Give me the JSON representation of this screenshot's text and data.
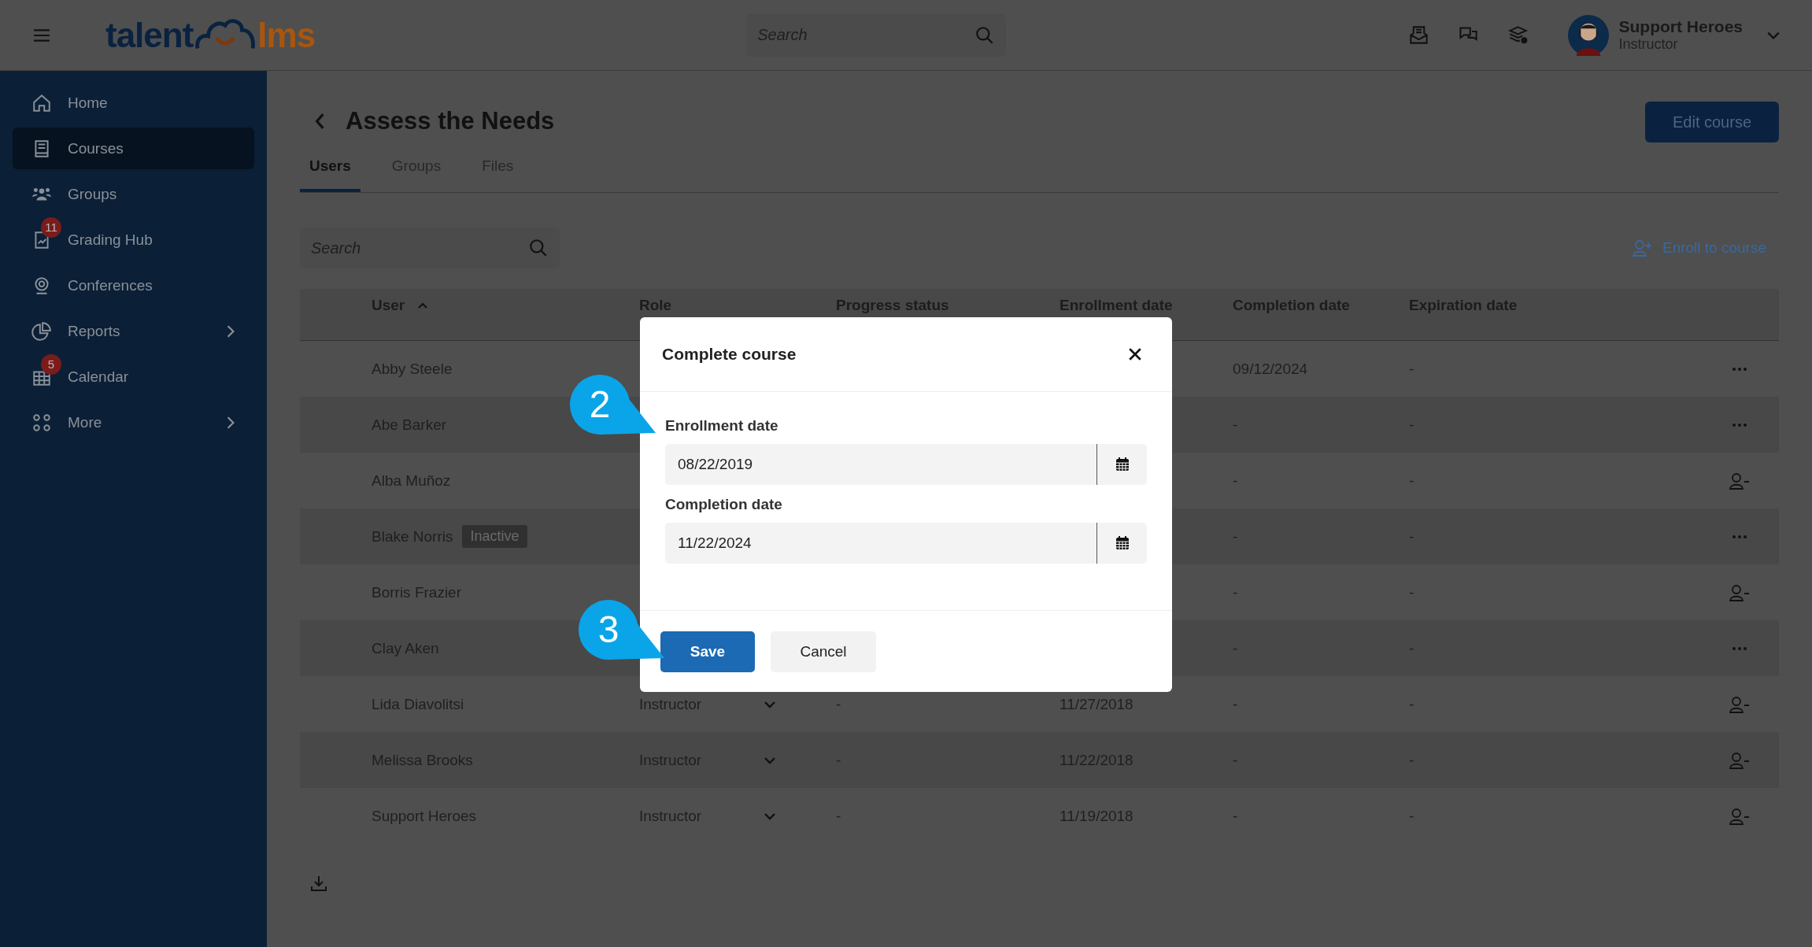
{
  "header": {
    "logo": {
      "left": "talent",
      "right": "lms"
    },
    "search": {
      "placeholder": "Search"
    },
    "user": {
      "name": "Support Heroes",
      "role": "Instructor"
    }
  },
  "sidebar": {
    "items": [
      {
        "label": "Home",
        "selected": false
      },
      {
        "label": "Courses",
        "selected": true
      },
      {
        "label": "Groups",
        "selected": false
      },
      {
        "label": "Grading Hub",
        "selected": false,
        "badge": "11"
      },
      {
        "label": "Conferences",
        "selected": false
      },
      {
        "label": "Reports",
        "selected": false,
        "submenu": true
      },
      {
        "label": "Calendar",
        "selected": false,
        "badge": "5"
      },
      {
        "label": "More",
        "selected": false,
        "submenu": true
      }
    ]
  },
  "page": {
    "title": "Assess the Needs",
    "edit_button": "Edit course",
    "tabs": [
      {
        "label": "Users",
        "selected": true
      },
      {
        "label": "Groups",
        "selected": false
      },
      {
        "label": "Files",
        "selected": false
      }
    ],
    "search": {
      "placeholder": "Search"
    },
    "enroll_link": "Enroll to course"
  },
  "table": {
    "columns": [
      "User",
      "Role",
      "Progress status",
      "Enrollment date",
      "Completion date",
      "Expiration date"
    ],
    "rows": [
      {
        "user": "Abby Steele",
        "completion": "09/12/2024",
        "expiration": "-",
        "kind": "more"
      },
      {
        "user": "Abe Barker",
        "completion": "-",
        "expiration": "-",
        "kind": "more"
      },
      {
        "user": "Alba Muñoz",
        "completion": "-",
        "expiration": "-",
        "kind": "unenroll"
      },
      {
        "user": "Blake Norris",
        "status": "Inactive",
        "completion": "-",
        "expiration": "-",
        "kind": "more"
      },
      {
        "user": "Borris Frazier",
        "completion": "-",
        "expiration": "-",
        "kind": "unenroll"
      },
      {
        "user": "Clay Aken",
        "completion": "-",
        "expiration": "-",
        "kind": "more"
      },
      {
        "user": "Lida Diavolitsi",
        "role": "Instructor",
        "progress": "-",
        "enrollment": "11/27/2018",
        "completion": "-",
        "expiration": "-",
        "kind": "unenroll"
      },
      {
        "user": "Melissa Brooks",
        "role": "Instructor",
        "progress": "-",
        "enrollment": "11/22/2018",
        "completion": "-",
        "expiration": "-",
        "kind": "unenroll"
      },
      {
        "user": "Support Heroes",
        "role": "Instructor",
        "progress": "-",
        "enrollment": "11/19/2018",
        "completion": "-",
        "expiration": "-",
        "kind": "unenroll"
      }
    ]
  },
  "dialog": {
    "title": "Complete course",
    "fields": [
      {
        "label": "Enrollment date",
        "value": "08/22/2019"
      },
      {
        "label": "Completion date",
        "value": "11/22/2024"
      }
    ],
    "buttons": [
      {
        "label": "Save",
        "kind": "primary"
      },
      {
        "label": "Cancel",
        "kind": "secondary"
      }
    ]
  },
  "callouts": [
    {
      "number": "2"
    },
    {
      "number": "3"
    }
  ]
}
